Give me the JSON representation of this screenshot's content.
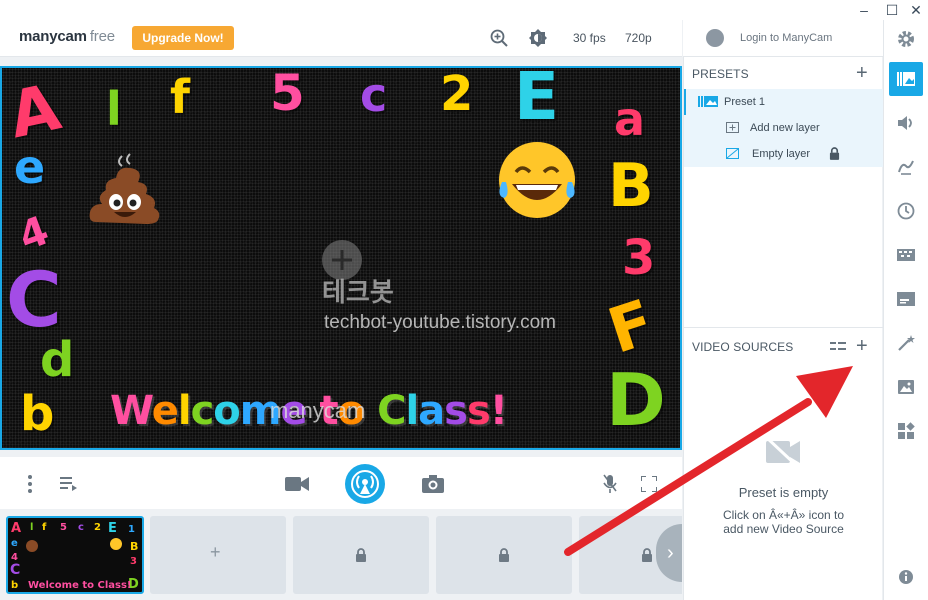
{
  "window": {
    "minimize": "–",
    "maximize": "☐",
    "close": "✕"
  },
  "toolbar": {
    "logo_brand": "manycam",
    "logo_edition": "free",
    "upgrade_label": "Upgrade Now!",
    "fps": "30 fps",
    "resolution": "720p"
  },
  "account": {
    "login_label": "Login to ManyCam"
  },
  "preview": {
    "letters": [
      "A",
      "l",
      "f",
      "5",
      "c",
      "2",
      "E",
      "a",
      "e",
      "B",
      "4",
      "3",
      "C",
      "F",
      "d",
      "D",
      "b"
    ],
    "welcome_text": "Welcome to Class!",
    "watermark_korean": "테크봇",
    "watermark_url": "techbot-youtube.tistory.com",
    "manycam_watermark": "manycam"
  },
  "presets": {
    "title": "PRESETS",
    "items": [
      {
        "label": "Preset 1"
      },
      {
        "label": "Add new layer"
      },
      {
        "label": "Empty layer"
      }
    ]
  },
  "video_sources": {
    "title": "VIDEO SOURCES",
    "empty_title": "Preset is empty",
    "empty_line1": "Click on Â«+Â» icon to",
    "empty_line2": "add new Video Source"
  },
  "colors": {
    "accent": "#19a8e6",
    "upgrade": "#f7a833",
    "arrow": "#e3262b"
  }
}
